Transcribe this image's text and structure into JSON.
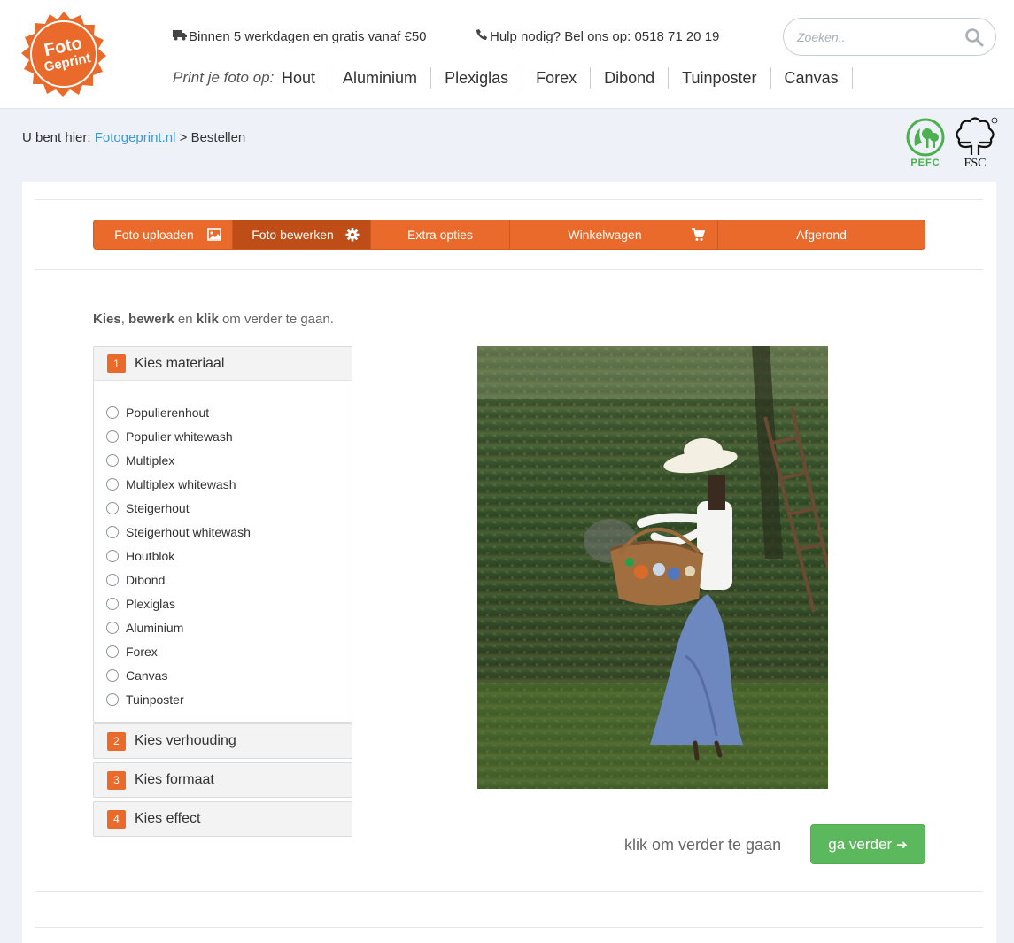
{
  "logo": {
    "line1": "Foto",
    "line2": "Geprint"
  },
  "header": {
    "shipping": "Binnen 5 werkdagen en gratis vanaf €50",
    "phone": "Hulp nodig? Bel ons op: 0518 71 20 19",
    "search_placeholder": "Zoeken..",
    "print_on_label": "Print je foto op:",
    "nav": [
      "Hout",
      "Aluminium",
      "Plexiglas",
      "Forex",
      "Dibond",
      "Tuinposter",
      "Canvas"
    ]
  },
  "breadcrumb": {
    "prefix": "U bent hier:",
    "home": "Fotogeprint.nl",
    "separator": ">",
    "current": "Bestellen"
  },
  "certifications": {
    "pefc": "PEFC",
    "fsc": "FSC"
  },
  "steps": [
    {
      "label": "Foto uploaden",
      "icon": "image-icon"
    },
    {
      "label": "Foto bewerken",
      "icon": "gear-icon",
      "active": true
    },
    {
      "label": "Extra opties"
    },
    {
      "label": "Winkelwagen",
      "icon": "cart-icon"
    },
    {
      "label": "Afgerond"
    }
  ],
  "intro": {
    "w1": "Kies",
    "w2": ",",
    "w3": "bewerk",
    "w4": "en",
    "w5": "klik",
    "w6": "om verder te gaan."
  },
  "accordion": [
    {
      "number": "1",
      "title": "Kies materiaal",
      "expanded": true
    },
    {
      "number": "2",
      "title": "Kies verhouding"
    },
    {
      "number": "3",
      "title": "Kies formaat"
    },
    {
      "number": "4",
      "title": "Kies effect"
    }
  ],
  "materials": [
    "Populierenhout",
    "Populier whitewash",
    "Multiplex",
    "Multiplex whitewash",
    "Steigerhout",
    "Steigerhout whitewash",
    "Houtblok",
    "Dibond",
    "Plexiglas",
    "Aluminium",
    "Forex",
    "Canvas",
    "Tuinposter"
  ],
  "cta": {
    "text": "klik om verder te gaan",
    "button": "ga verder",
    "arrow": "➔"
  },
  "colors": {
    "brand_orange": "#ea6a2b",
    "active_step": "#bf4d17",
    "cta_green": "#5cb85c",
    "link_blue": "#3a9ad9"
  }
}
